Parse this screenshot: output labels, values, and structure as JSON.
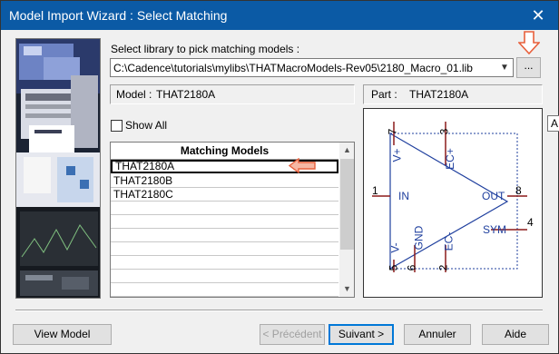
{
  "window": {
    "title": "Model Import Wizard : Select Matching",
    "close_glyph": "✕"
  },
  "library": {
    "label": "Select library to pick matching models :",
    "path": "C:\\Cadence\\tutorials\\mylibs\\THATMacroModels-Rev05\\2180_Macro_01.lib",
    "browse_label": "..."
  },
  "model": {
    "label": "Model :",
    "value": "THAT2180A"
  },
  "part": {
    "label": "Part :",
    "value": "THAT2180A"
  },
  "show_all": {
    "label": "Show All",
    "checked": false
  },
  "matching": {
    "header": "Matching Models",
    "items": [
      "THAT2180A",
      "THAT2180B",
      "THAT2180C"
    ],
    "selected_index": 0
  },
  "symbol": {
    "pins": [
      {
        "num": "7",
        "name": "V+"
      },
      {
        "num": "3",
        "name": "EC+"
      },
      {
        "num": "1",
        "name": "IN"
      },
      {
        "num": "8",
        "name": "OUT"
      },
      {
        "num": "4",
        "name": "SYM"
      },
      {
        "num": "5",
        "name": "V-"
      },
      {
        "num": "6",
        "name": "GND"
      },
      {
        "num": "2",
        "name": "EC-"
      }
    ],
    "color": "#1f3f9e",
    "pin_color": "#8b1a1a"
  },
  "tooltip_fragment": "A",
  "buttons": {
    "view_model": "View Model",
    "previous": "< Précédent",
    "next": "Suivant >",
    "cancel": "Annuler",
    "help": "Aide"
  },
  "annotation_color": "#e8603c"
}
